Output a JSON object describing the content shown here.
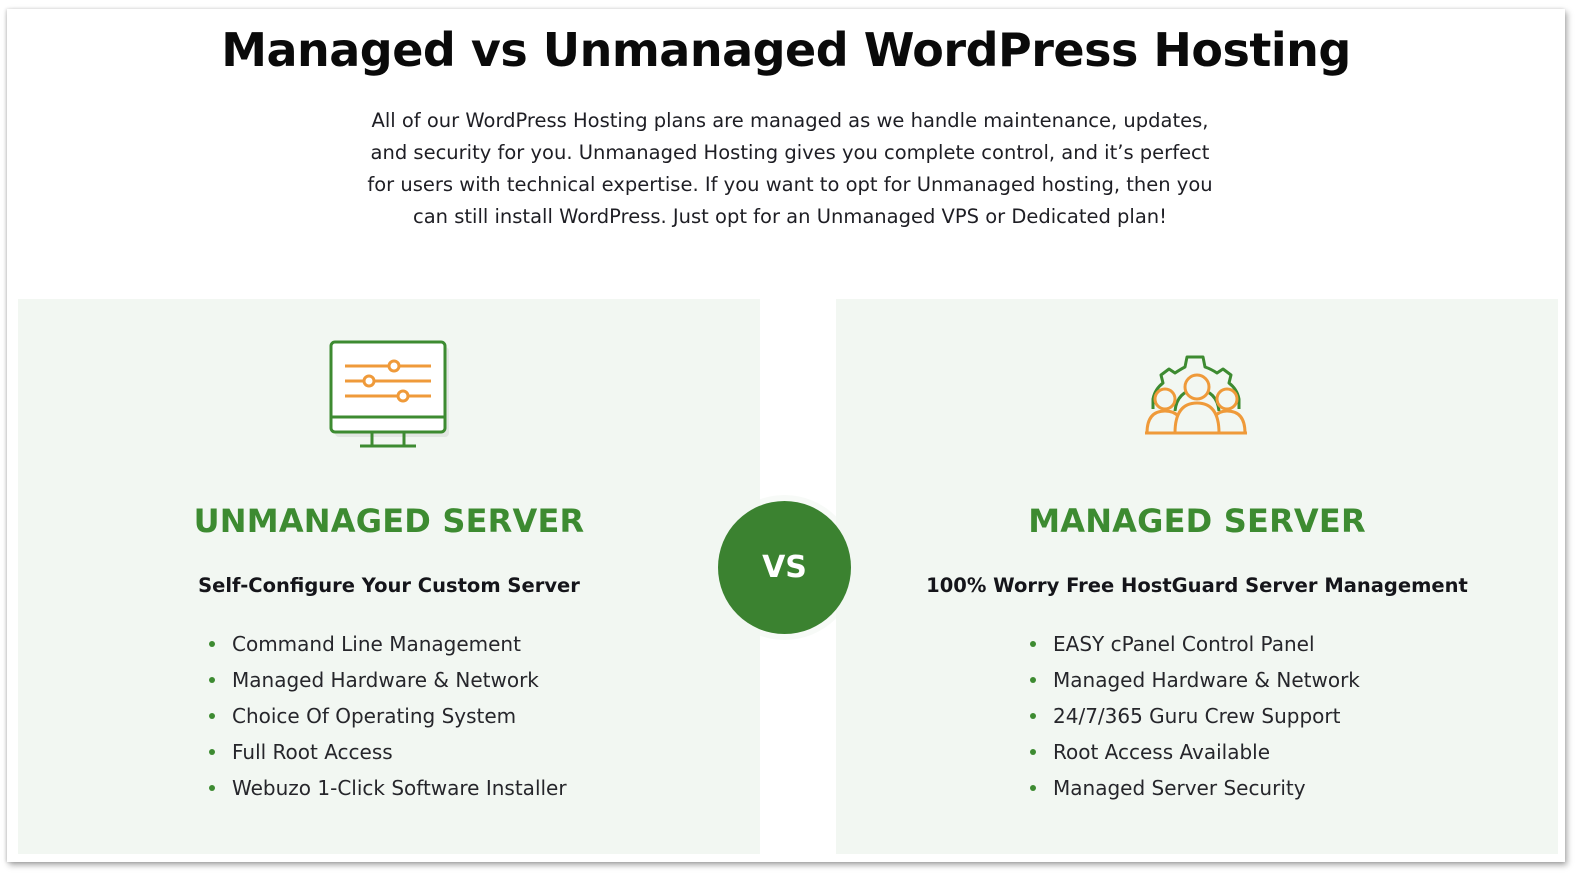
{
  "header": {
    "title": "Managed vs Unmanaged WordPress Hosting",
    "intro_lines": [
      "All of our WordPress Hosting plans are managed as we handle maintenance, updates,",
      "and security for you. Unmanaged Hosting gives you complete control, and it’s perfect",
      "for users with technical expertise. If you want to opt for Unmanaged hosting, then you",
      "can still install WordPress. Just opt for an Unmanaged VPS or Dedicated plan!"
    ]
  },
  "colors": {
    "accent_green": "#3d8b31",
    "icon_orange": "#ef9a3a",
    "panel_background": "#f2f7f2"
  },
  "vs_badge": {
    "label": "VS"
  },
  "panels": {
    "unmanaged": {
      "icon": "monitor-sliders-icon",
      "title": "UNMANAGED SERVER",
      "subtitle": "Self-Configure Your Custom Server",
      "features": [
        "Command Line Management",
        "Managed Hardware & Network",
        "Choice Of Operating System",
        "Full Root Access",
        "Webuzo 1-Click Software Installer"
      ]
    },
    "managed": {
      "icon": "team-gear-icon",
      "title": "MANAGED SERVER",
      "subtitle": "100% Worry Free HostGuard Server Management",
      "features": [
        "EASY cPanel Control Panel",
        "Managed Hardware & Network",
        "24/7/365 Guru Crew Support",
        "Root Access Available",
        "Managed Server Security"
      ]
    }
  }
}
